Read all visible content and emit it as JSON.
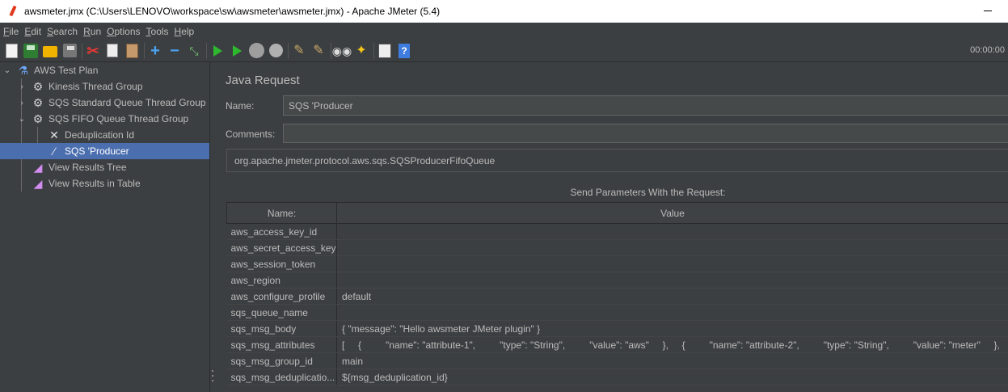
{
  "window": {
    "title": "awsmeter.jmx (C:\\Users\\LENOVO\\workspace\\sw\\awsmeter\\awsmeter.jmx) - Apache JMeter (5.4)"
  },
  "menu": [
    {
      "first": "F",
      "rest": "ile"
    },
    {
      "first": "E",
      "rest": "dit"
    },
    {
      "first": "S",
      "rest": "earch"
    },
    {
      "first": "R",
      "rest": "un"
    },
    {
      "first": "O",
      "rest": "ptions"
    },
    {
      "first": "T",
      "rest": "ools"
    },
    {
      "first": "H",
      "rest": "elp"
    }
  ],
  "toolbar": {
    "timer": "00:00:00",
    "icons": [
      "new-icon",
      "templates-icon",
      "open-icon",
      "save-icon",
      "cut-icon",
      "copy-icon",
      "paste-icon",
      "expand-icon",
      "collapse-icon",
      "toggle-icon",
      "start-icon",
      "start-no-pauses-icon",
      "stop-icon",
      "shutdown-icon",
      "clear-icon",
      "clear-all-icon",
      "search-icon",
      "reset-search-icon",
      "function-helper-icon",
      "help-icon"
    ],
    "help_glyph": "?"
  },
  "tree": {
    "items": [
      {
        "label": "AWS Test Plan",
        "icon": "test-plan-icon"
      },
      {
        "label": "Kinesis Thread Group",
        "icon": "thread-group-icon"
      },
      {
        "label": "SQS Standard Queue Thread Group",
        "icon": "thread-group-icon"
      },
      {
        "label": "SQS FIFO Queue Thread Group",
        "icon": "thread-group-icon"
      },
      {
        "label": "Deduplication Id",
        "icon": "config-element-icon"
      },
      {
        "label": "SQS 'Producer",
        "icon": "java-sampler-icon",
        "selected": true
      },
      {
        "label": "View Results Tree",
        "icon": "listener-icon"
      },
      {
        "label": "View Results in Table",
        "icon": "listener-icon"
      }
    ]
  },
  "panel": {
    "title": "Java Request",
    "name_label": "Name:",
    "name_value": "SQS 'Producer",
    "comments_label": "Comments:",
    "comments_value": "",
    "classname": "org.apache.jmeter.protocol.aws.sqs.SQSProducerFifoQueue",
    "params_caption": "Send Parameters With the Request:",
    "columns": [
      "Name:",
      "Value"
    ],
    "params": [
      {
        "name": "aws_access_key_id",
        "value": ""
      },
      {
        "name": "aws_secret_access_key",
        "value": ""
      },
      {
        "name": "aws_session_token",
        "value": ""
      },
      {
        "name": "aws_region",
        "value": ""
      },
      {
        "name": "aws_configure_profile",
        "value": "default"
      },
      {
        "name": "sqs_queue_name",
        "value": ""
      },
      {
        "name": "sqs_msg_body",
        "value": "{     \"message\": \"Hello awsmeter JMeter plugin\" }"
      },
      {
        "name": "sqs_msg_attributes",
        "value": "[     {         \"name\": \"attribute-1\",         \"type\": \"String\",         \"value\": \"aws\"     },     {         \"name\": \"attribute-2\",         \"type\": \"String\",         \"value\": \"meter\"     },     {"
      },
      {
        "name": "sqs_msg_group_id",
        "value": "main"
      },
      {
        "name": "sqs_msg_deduplicatio...",
        "value": "${msg_deduplication_id}"
      }
    ]
  },
  "colors": {
    "background": "#3c3f41",
    "selection": "#4b6eaf",
    "text": "#bbbbbb"
  }
}
